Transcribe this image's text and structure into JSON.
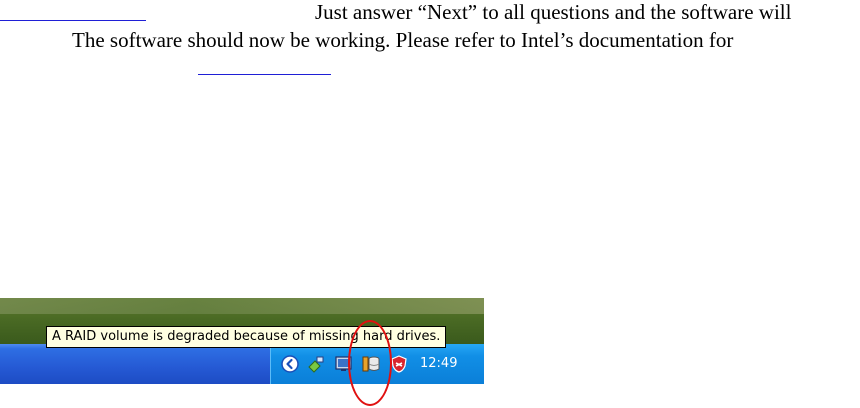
{
  "document": {
    "line1": "Just answer “Next” to all questions and the software will",
    "line2": "The software should now be working. Please refer to Intel’s documentation for"
  },
  "screenshot": {
    "tooltip": "A RAID volume is degraded because of missing hard drives.",
    "clock": "12:49",
    "tray_icons": [
      "back-arrow-icon",
      "network-icon",
      "monitor-icon",
      "raid-storage-icon",
      "security-shield-icon"
    ],
    "highlight_color": "#e01010"
  },
  "colors": {
    "link": "#1f1fd6",
    "taskbar": "#2559d4",
    "tray": "#0b7fd8",
    "tooltip_bg": "#ffffe1"
  }
}
